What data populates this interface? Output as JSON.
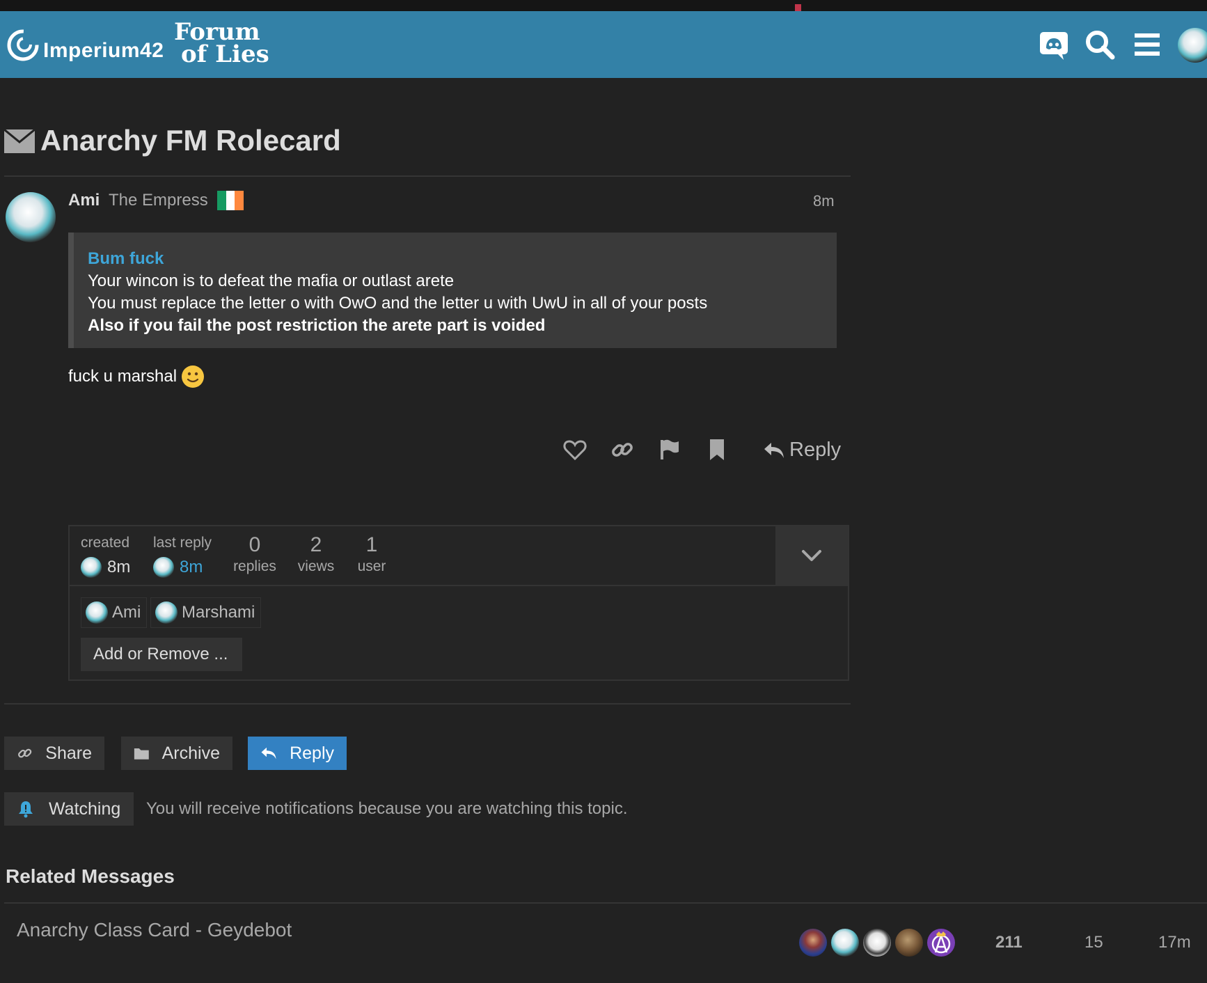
{
  "header": {
    "site_name": "Imperium42",
    "forum_logo_line1": "Forum",
    "forum_logo_line2": "of Lies",
    "icons": [
      "discord-icon",
      "search-icon",
      "hamburger-menu-icon",
      "user-avatar"
    ]
  },
  "topic": {
    "title": "Anarchy FM Rolecard",
    "type_icon": "envelope-icon"
  },
  "post": {
    "username": "Ami",
    "user_title": "The Empress",
    "flag": "ireland-flag",
    "time": "8m",
    "quote": {
      "title": "Bum fuck",
      "line1": "Your wincon is to defeat the mafia or outlast arete",
      "line2": "You must replace the letter o with OwO and the letter u with UwU in all of your posts",
      "line3": "Also if you fail the post restriction the arete part is voided"
    },
    "body_text": "fuck u marshal",
    "emoji": "slightly-smiling-face",
    "actions": {
      "reply_label": "Reply",
      "icons": [
        "heart-icon",
        "link-icon",
        "flag-icon",
        "bookmark-icon",
        "reply-icon"
      ]
    }
  },
  "topic_map": {
    "created_label": "created",
    "created_value": "8m",
    "last_reply_label": "last reply",
    "last_reply_value": "8m",
    "replies_count": "0",
    "replies_label": "replies",
    "views_count": "2",
    "views_label": "views",
    "users_count": "1",
    "users_label": "user",
    "participants": [
      "Ami",
      "Marshami"
    ],
    "add_remove_label": "Add or Remove ..."
  },
  "footer_buttons": {
    "share": "Share",
    "archive": "Archive",
    "reply": "Reply"
  },
  "notification": {
    "level": "Watching",
    "text": "You will receive notifications because you are watching this topic."
  },
  "related": {
    "heading": "Related Messages",
    "items": [
      {
        "title": "Anarchy Class Card - Geydebot",
        "posts": "211",
        "views": "15",
        "activity": "17m"
      }
    ]
  },
  "colors": {
    "header_bg": "#3381a7",
    "page_bg": "#222222",
    "accent": "#3ea6d9",
    "primary_button": "#3381c2"
  }
}
